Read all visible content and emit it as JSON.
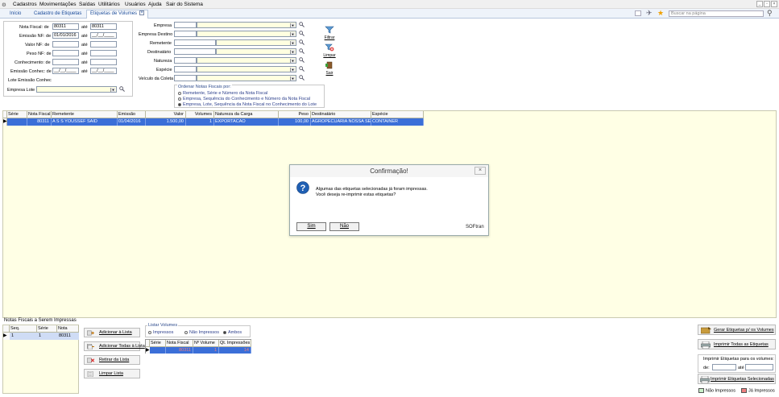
{
  "menu": {
    "items": [
      "Cadastros",
      "Movimentações",
      "Saídas",
      "Utilitários",
      "Usuários",
      "Ajuda",
      "Sair do Sistema"
    ]
  },
  "tabs": {
    "items": [
      "Início",
      "Cadastro de Etiquetas",
      "Etiquetas de Volumes"
    ],
    "search_placeholder": "Buscar na página"
  },
  "filters": {
    "nota_fiscal_label": "Nota Fiscal: de",
    "nota_fiscal_from": "80311",
    "nota_fiscal_to": "80311",
    "emissao_nf_label": "Emissão NF: de",
    "emissao_nf_from": "01/01/2016",
    "emissao_nf_to": "__/__/____",
    "valor_nf_label": "Valor NF: de",
    "peso_nf_label": "Peso NF: de",
    "conhecimento_label": "Conhecimento: de",
    "emissao_conhec_label": "Emissão Conhec: de",
    "emissao_conhec_from": "__/__/____",
    "emissao_conhec_to": "__/__/____",
    "lote_emissao_label": "Lote Emissão Conhec",
    "empresa_lote_label": "Empresa Lote",
    "ate": "até"
  },
  "right_filters": {
    "labels": [
      "Empresa",
      "Empresa Destino",
      "Remetente",
      "Destinatário",
      "Natureza",
      "Espécie",
      "Veículo da Coleta"
    ]
  },
  "side_buttons": {
    "filtrar": "Filtrar",
    "limpar": "Limpar",
    "sair": "Sair"
  },
  "order": {
    "title": "Ordenar Notas Fiscais por:",
    "options": [
      "Remetente, Série e Número da Nota Fiscal",
      "Empresa, Sequência do Conhecimento e Número da Nota Fiscal",
      "Empresa, Lote, Sequência da Nota Fiscal no Conhecimento do Lote"
    ],
    "selected": 2
  },
  "grid": {
    "columns": [
      "Série",
      "Nota Fiscal",
      "Remetente",
      "Emissão",
      "Valor",
      "Volumes",
      "Natureza da Carga",
      "Peso",
      "Destinatário",
      "Espécie"
    ],
    "rows": [
      [
        "",
        "80311",
        "A S S YOUSSEF SAID",
        "01/04/2016",
        "1.500,00",
        "1",
        "EXPORTACAO",
        "100,00",
        "AGROPECUARIA NOSSA SEN",
        "CONTAINER"
      ]
    ]
  },
  "dialog": {
    "title": "Confirmação!",
    "line1": "Algumas das etiquetas selecionadas já foram impressas.",
    "line2": "Você deseja re-imprimir estas etiquetas?",
    "yes": "Sim",
    "no": "Não",
    "brand": "SOFtran"
  },
  "bottom": {
    "section_label": "Notas Fiscais a Serem Impressas",
    "list_columns": [
      "Seq.",
      "Série",
      "Nota"
    ],
    "list_rows": [
      [
        "1",
        "1",
        "80311"
      ]
    ],
    "add_button": "Adicionar à Lista",
    "add_all_button": "Adicionar Todas à Lista",
    "remove_button": "Retirar da Lista",
    "clear_button": "Limpar Lista",
    "volumes_title": "Listar Volumes",
    "volumes_options": [
      "Impressos",
      "Não Impressos",
      "Ambos"
    ],
    "volumes_selected": 2,
    "vol_columns": [
      "Série",
      "Nota Fiscal",
      "Nº Volume",
      "Qt. Impressões"
    ],
    "vol_rows": [
      [
        "",
        "80311",
        "1",
        "14"
      ]
    ],
    "gerar_button": "Gerar Etiquetas p/ os Volumes",
    "imprimir_todas_button": "Imprimir Todas as Etiquetas",
    "range_title": "Imprimir Etiquetas para os volumes:",
    "range_de": "de:",
    "range_ate": "até",
    "imprimir_sel_button": "Imprimir Etiquetas Selecionadas",
    "legend_not_printed": "Não Impressos",
    "legend_printed": "Já Impressos"
  },
  "colors": {
    "selection": "#3b6fd8",
    "grid_bg": "#ffffe5",
    "legend_not_printed": "#c8f0c8",
    "legend_printed": "#f08080"
  }
}
